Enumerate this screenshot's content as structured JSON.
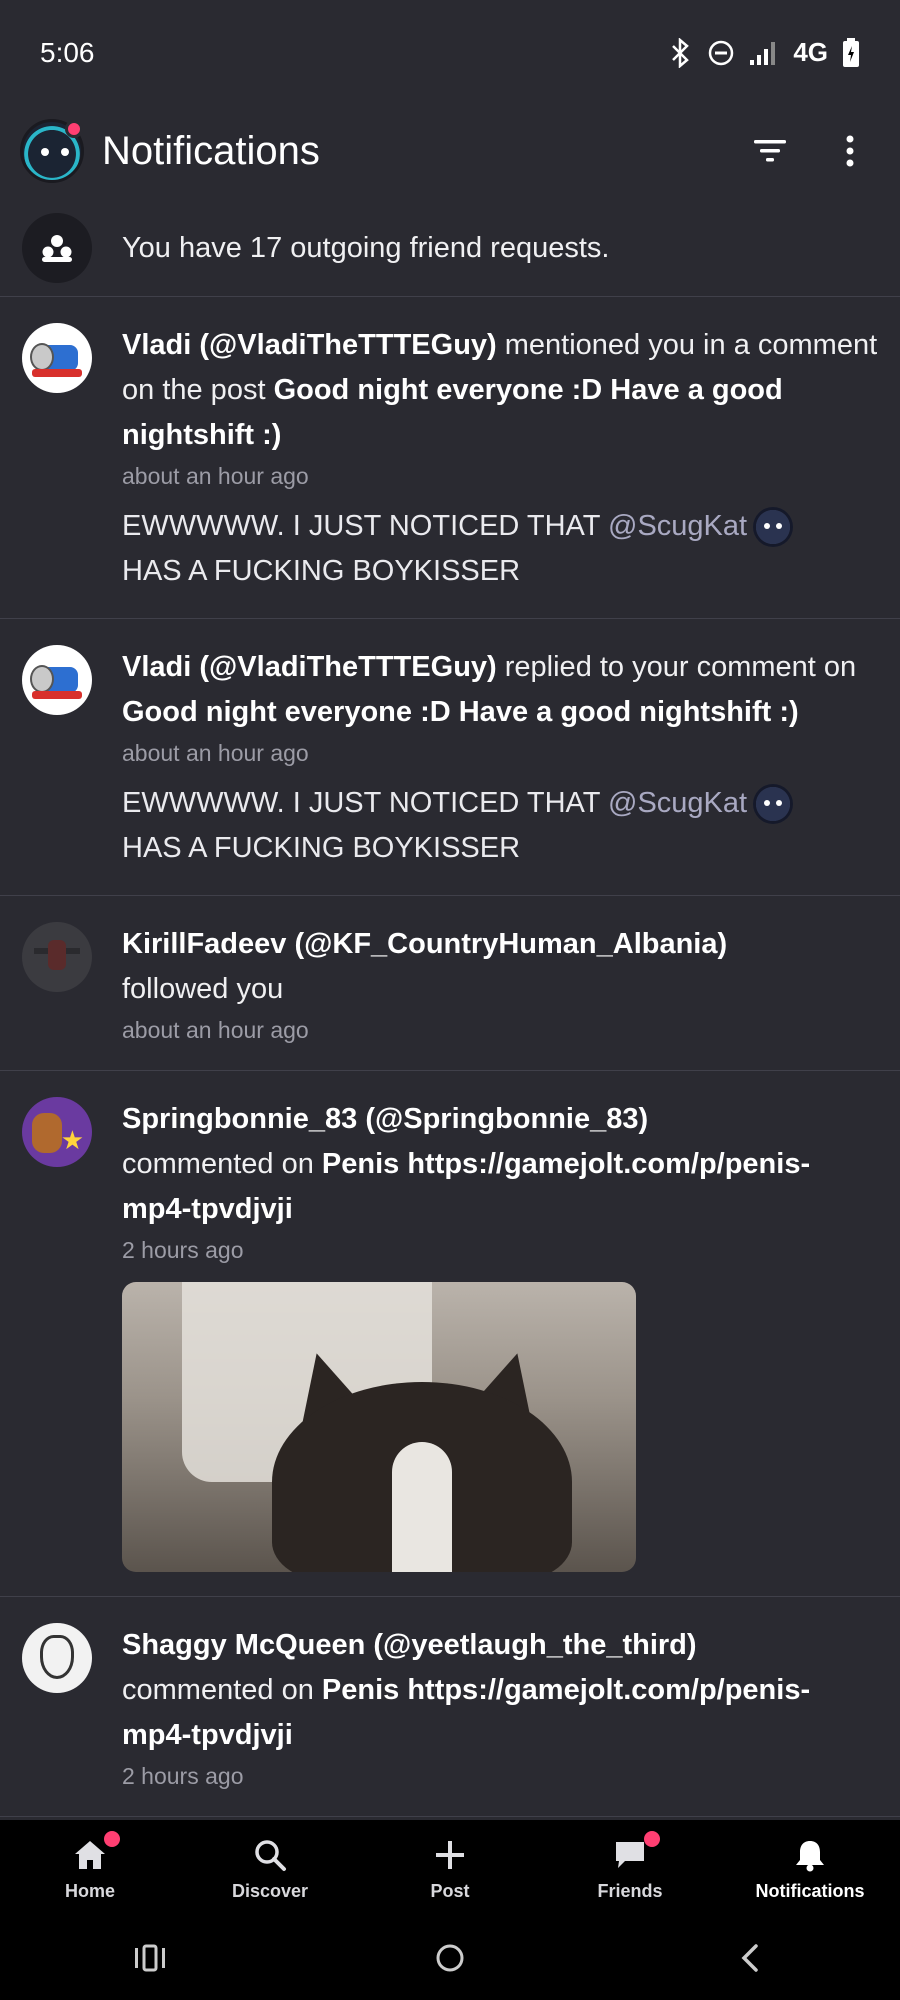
{
  "status_bar": {
    "time": "5:06",
    "network": "4G"
  },
  "header": {
    "title": "Notifications"
  },
  "banner": {
    "text": "You have 17 outgoing friend requests."
  },
  "notifications": [
    {
      "actor": "Vladi (@VladiTheTTTEGuy)",
      "action": " mentioned you in a comment on the post ",
      "target": "Good night everyone :D Have a good nightshift :)",
      "time": "about an hour ago",
      "quote_before": "EWWWWW. I JUST NOTICED THAT ",
      "quote_mention": "@ScugKat",
      "quote_after": "HAS A FUCKING BOYKISSER"
    },
    {
      "actor": "Vladi (@VladiTheTTTEGuy)",
      "action": " replied to your comment on ",
      "target": "Good night everyone :D Have a good nightshift :)",
      "time": "about an hour ago",
      "quote_before": "EWWWWW. I JUST NOTICED THAT ",
      "quote_mention": "@ScugKat",
      "quote_after": "HAS A FUCKING BOYKISSER"
    },
    {
      "actor": "KirillFadeev (@KF_CountryHuman_Albania)",
      "action": " followed you",
      "time": "about an hour ago"
    },
    {
      "actor": "Springbonnie_83 (@Springbonnie_83)",
      "action": " commented on ",
      "target": "Penis https://gamejolt.com/p/penis-mp4-tpvdjvji",
      "time": "2 hours ago"
    },
    {
      "actor": "Shaggy McQueen (@yeetlaugh_the_third)",
      "action": " commented on ",
      "target": "Penis https://gamejolt.com/p/penis-mp4-tpvdjvji",
      "time": "2 hours ago"
    }
  ],
  "tabs": [
    {
      "label": "Home"
    },
    {
      "label": "Discover"
    },
    {
      "label": "Post"
    },
    {
      "label": "Friends"
    },
    {
      "label": "Notifications"
    }
  ],
  "colors": {
    "accent_dot": "#ff3f72",
    "background": "#2a2a31",
    "tab_bar": "#000000"
  }
}
